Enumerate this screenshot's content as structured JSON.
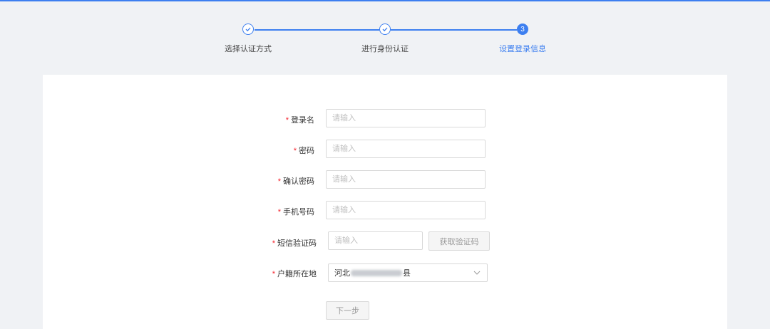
{
  "theme": {
    "accent": "#3d7ff0",
    "required": "#f5222d",
    "background": "#f0f2f5"
  },
  "steps": [
    {
      "label": "选择认证方式",
      "state": "done",
      "icon": "check-icon"
    },
    {
      "label": "进行身份认证",
      "state": "done",
      "icon": "check-icon"
    },
    {
      "label": "设置登录信息",
      "state": "active",
      "number": "3"
    }
  ],
  "form": {
    "required_mark": "*",
    "login_name": {
      "label": "登录名",
      "placeholder": "请输入",
      "value": ""
    },
    "password": {
      "label": "密码",
      "placeholder": "请输入",
      "value": ""
    },
    "confirm_password": {
      "label": "确认密码",
      "placeholder": "请输入",
      "value": ""
    },
    "phone": {
      "label": "手机号码",
      "placeholder": "请输入",
      "value": ""
    },
    "sms_code": {
      "label": "短信验证码",
      "placeholder": "请输入",
      "value": "",
      "button": "获取验证码"
    },
    "residence": {
      "label": "户籍所在地",
      "value_start": "河北",
      "value_end": "县",
      "redacted": true,
      "icon": "chevron-down-icon"
    },
    "next_button": "下一步"
  }
}
